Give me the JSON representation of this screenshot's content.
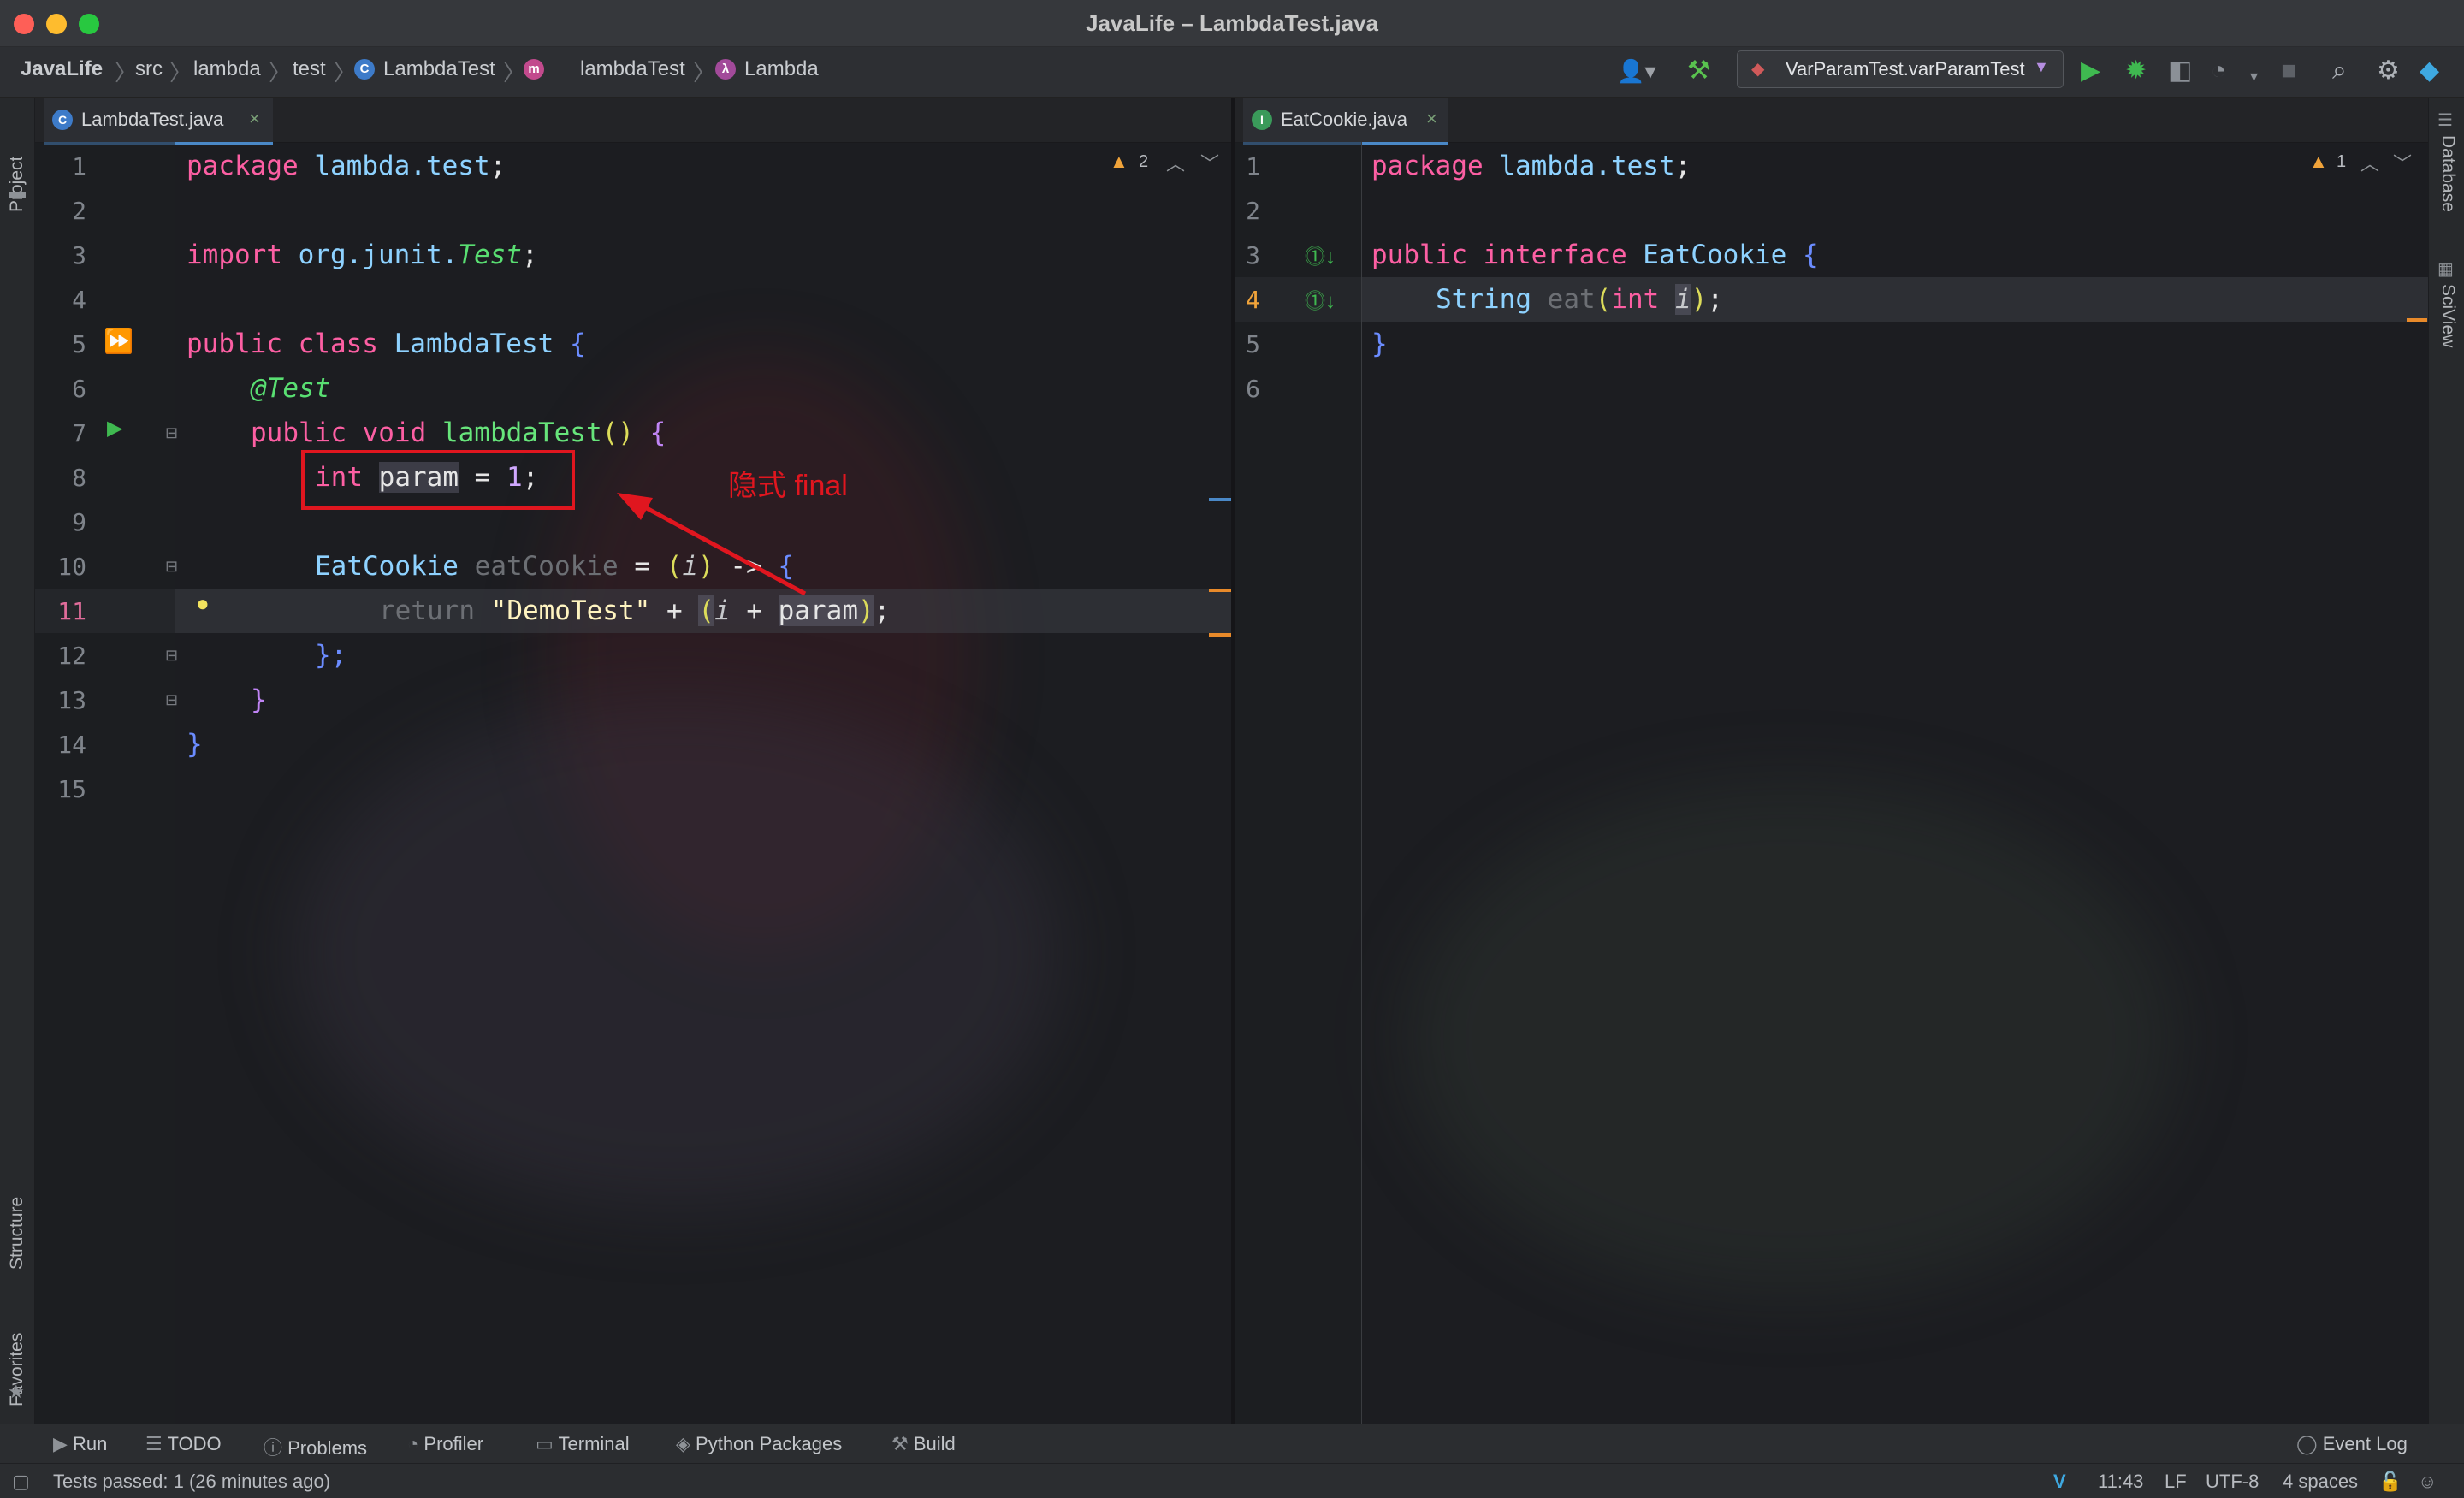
{
  "window": {
    "title": "JavaLife – LambdaTest.java"
  },
  "breadcrumbs": [
    "JavaLife",
    "src",
    "lambda",
    "test",
    "LambdaTest",
    "lambdaTest",
    "Lambda"
  ],
  "run_config": "VarParamTest.varParamTest",
  "left_strip": {
    "project": "Project",
    "structure": "Structure",
    "favorites": "Favorites"
  },
  "right_strip": {
    "database": "Database",
    "sciview": "SciView"
  },
  "left_editor": {
    "tab": "LambdaTest.java",
    "warnings": "2",
    "lines": [
      "1",
      "2",
      "3",
      "4",
      "5",
      "6",
      "7",
      "8",
      "9",
      "10",
      "11",
      "12",
      "13",
      "14",
      "15"
    ],
    "current_line": "11",
    "code": {
      "l1_kw": "package",
      "l1_pkg": "lambda.test",
      "l1_semi": ";",
      "l3_kw": "import",
      "l3_pkg": "org.junit.",
      "l3_cls": "Test",
      "l3_semi": ";",
      "l5_kw": "public class",
      "l5_cls": "LambdaTest",
      "l5_br": "{",
      "l6_ann": "@Test",
      "l7_kw": "public void",
      "l7_fn": "lambdaTest",
      "l7_paren": "()",
      "l7_br": "{",
      "l8_kw": "int",
      "l8_var": "param",
      "l8_eq": "=",
      "l8_num": "1",
      "l8_semi": ";",
      "l10_typ": "EatCookie",
      "l10_var": "eatCookie",
      "l10_eq": "=",
      "l10_lp": "(",
      "l10_i": "i",
      "l10_rp": ")",
      "l10_arrow": "->",
      "l10_br": "{",
      "l11_kw": "return",
      "l11_str": "\"DemoTest\"",
      "l11_plus": "+",
      "l11_lp": "(",
      "l11_i": "i",
      "l11_plus2": "+",
      "l11_param": "param",
      "l11_rp": ")",
      "l11_semi": ";",
      "l12": "};",
      "l13": "}",
      "l14": "}"
    },
    "annotation": "隐式 final"
  },
  "right_editor": {
    "tab": "EatCookie.java",
    "warnings": "1",
    "lines": [
      "1",
      "2",
      "3",
      "4",
      "5",
      "6"
    ],
    "current_line": "4",
    "code": {
      "l1_kw": "package",
      "l1_pkg": "lambda.test",
      "l1_semi": ";",
      "l3_kw": "public interface",
      "l3_cls": "EatCookie",
      "l3_br": "{",
      "l4_typ": "String",
      "l4_fn": "eat",
      "l4_lp": "(",
      "l4_kw": "int",
      "l4_i": "i",
      "l4_rp": ")",
      "l4_semi": ";",
      "l5": "}"
    }
  },
  "tool_windows": [
    "Run",
    "TODO",
    "Problems",
    "Profiler",
    "Terminal",
    "Python Packages",
    "Build"
  ],
  "event_log": "Event Log",
  "status": {
    "message": "Tests passed: 1 (26 minutes ago)",
    "time": "11:43",
    "line_sep": "LF",
    "encoding": "UTF-8",
    "indent": "4 spaces"
  },
  "colors": {
    "accent": "#4a88c7",
    "annotation_red": "#e0161f",
    "keyword": "#fc5fa3"
  }
}
